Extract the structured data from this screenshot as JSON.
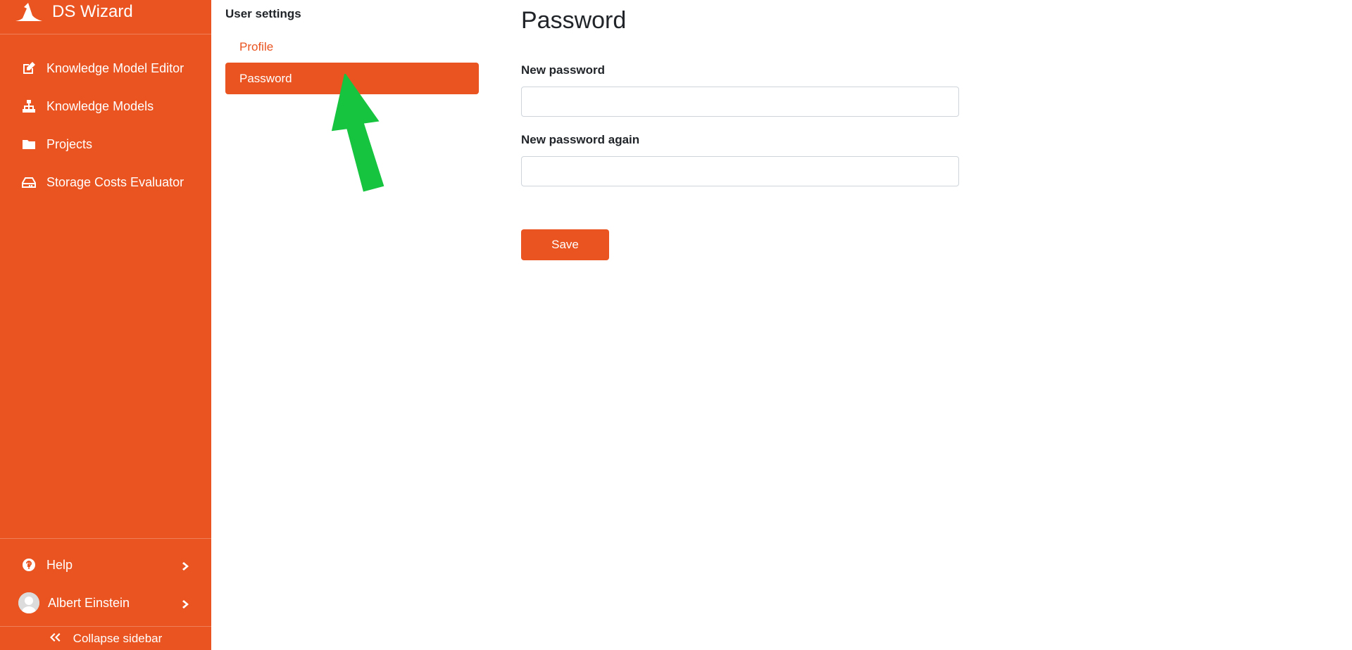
{
  "brand": {
    "name": "DS Wizard"
  },
  "sidebar": {
    "items": [
      {
        "label": "Knowledge Model Editor",
        "icon": "edit-icon"
      },
      {
        "label": "Knowledge Models",
        "icon": "sitemap-icon"
      },
      {
        "label": "Projects",
        "icon": "folder-icon"
      },
      {
        "label": "Storage Costs Evaluator",
        "icon": "hdd-icon"
      }
    ],
    "bottom": {
      "help_label": "Help",
      "user_name": "Albert Einstein",
      "collapse_label": "Collapse sidebar"
    }
  },
  "settings": {
    "title": "User settings",
    "links": [
      {
        "label": "Profile",
        "active": false
      },
      {
        "label": "Password",
        "active": true
      }
    ]
  },
  "form": {
    "title": "Password",
    "new_password_label": "New password",
    "new_password_value": "",
    "new_password_again_label": "New password again",
    "new_password_again_value": "",
    "save_label": "Save"
  },
  "colors": {
    "accent": "#e95420",
    "annotation_arrow": "#16c440"
  }
}
